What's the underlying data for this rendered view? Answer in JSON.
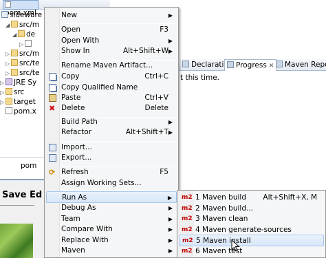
{
  "explorer": {
    "top_item": "pom.xml",
    "rows": [
      {
        "label": "sideware",
        "kind": "project"
      },
      {
        "label": "src/m",
        "kind": "folder"
      },
      {
        "label": "de",
        "kind": "folder"
      },
      {
        "label": "",
        "kind": "file"
      },
      {
        "label": "src/m",
        "kind": "folder"
      },
      {
        "label": "src/te",
        "kind": "folder"
      },
      {
        "label": "src/te",
        "kind": "folder"
      },
      {
        "label": "JRE Sy",
        "kind": "jar"
      },
      {
        "label": "src",
        "kind": "folder"
      },
      {
        "label": "target",
        "kind": "folder"
      },
      {
        "label": "pom.x",
        "kind": "file"
      }
    ],
    "bottom_tab": "pom"
  },
  "views": {
    "tabs": [
      {
        "label": "Declaration"
      },
      {
        "label": "Progress",
        "close": "✕"
      },
      {
        "label": "Maven Reposito"
      }
    ],
    "message": "t this time."
  },
  "page": {
    "heading": "Save Ed"
  },
  "context_menu": {
    "items": [
      {
        "label": "New",
        "accel": "",
        "submenu": true
      },
      {
        "label": "Open",
        "accel": "F3"
      },
      {
        "label": "Open With",
        "accel": "",
        "submenu": true
      },
      {
        "label": "Show In",
        "accel": "Alt+Shift+W",
        "submenu": true
      },
      {
        "label": "Rename Maven Artifact...",
        "accel": ""
      },
      {
        "label": "Copy",
        "accel": "Ctrl+C",
        "icon": "copy-icon"
      },
      {
        "label": "Copy Qualified Name",
        "accel": "",
        "icon": "copy-qualified-icon"
      },
      {
        "label": "Paste",
        "accel": "Ctrl+V",
        "icon": "paste-icon"
      },
      {
        "label": "Delete",
        "accel": "Delete",
        "icon": "delete-icon"
      },
      {
        "label": "Build Path",
        "accel": "",
        "submenu": true
      },
      {
        "label": "Refactor",
        "accel": "Alt+Shift+T",
        "submenu": true
      },
      {
        "label": "Import...",
        "accel": "",
        "icon": "import-icon"
      },
      {
        "label": "Export...",
        "accel": "",
        "icon": "export-icon"
      },
      {
        "label": "Refresh",
        "accel": "F5",
        "icon": "refresh-icon"
      },
      {
        "label": "Assign Working Sets...",
        "accel": ""
      },
      {
        "label": "Run As",
        "accel": "",
        "submenu": true,
        "highlighted": true
      },
      {
        "label": "Debug As",
        "accel": "",
        "submenu": true
      },
      {
        "label": "Team",
        "accel": "",
        "submenu": true
      },
      {
        "label": "Compare With",
        "accel": "",
        "submenu": true
      },
      {
        "label": "Replace With",
        "accel": "",
        "submenu": true
      },
      {
        "label": "Maven",
        "accel": "",
        "submenu": true
      }
    ]
  },
  "run_as_menu": {
    "badge": "m2",
    "items": [
      {
        "label": "1 Maven build",
        "accel": "Alt+Shift+X, M"
      },
      {
        "label": "2 Maven build...",
        "accel": ""
      },
      {
        "label": "3 Maven clean",
        "accel": ""
      },
      {
        "label": "4 Maven generate-sources",
        "accel": ""
      },
      {
        "label": "5 Maven install",
        "accel": "",
        "highlighted": true
      },
      {
        "label": "6 Maven test",
        "accel": ""
      }
    ]
  },
  "colors": {
    "menu_bg": "#f5f6f7",
    "highlight": "#d7e6f8",
    "m2_badge": "#c00000"
  }
}
